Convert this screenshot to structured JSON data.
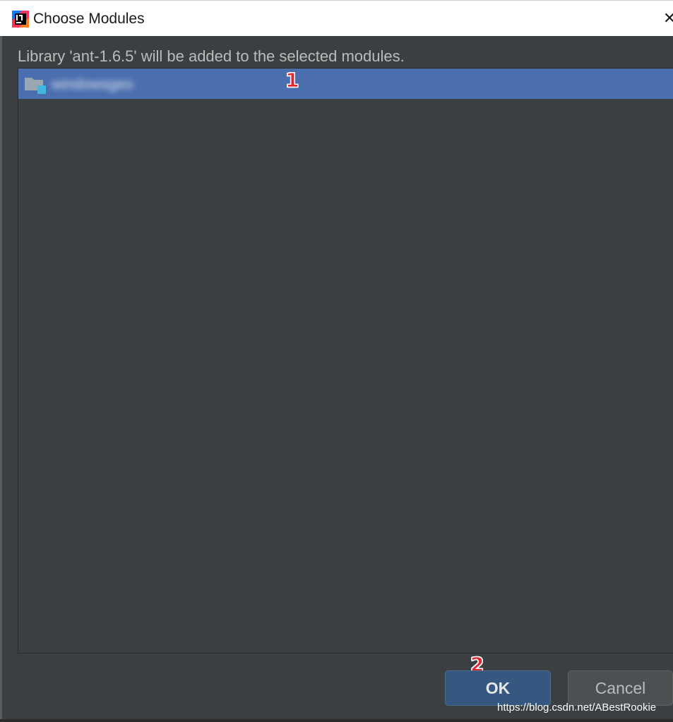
{
  "window": {
    "title": "Choose Modules",
    "close_glyph": "✕",
    "icon": "intellij-idea-icon"
  },
  "dialog": {
    "message": "Library 'ant-1.6.5' will be added to the selected modules."
  },
  "modules": [
    {
      "name": "windowsgeo",
      "icon": "module-folder-icon",
      "selected": true
    }
  ],
  "annotations": {
    "marker_1": "1",
    "marker_2": "2"
  },
  "buttons": {
    "ok_label": "OK",
    "cancel_label": "Cancel"
  },
  "watermark": "https://blog.csdn.net/ABestRookie",
  "colors": {
    "dialog_bg": "#3c3f41",
    "selection": "#4b6eaf",
    "ok_button": "#365880",
    "annotation_red": "#e3262e"
  }
}
